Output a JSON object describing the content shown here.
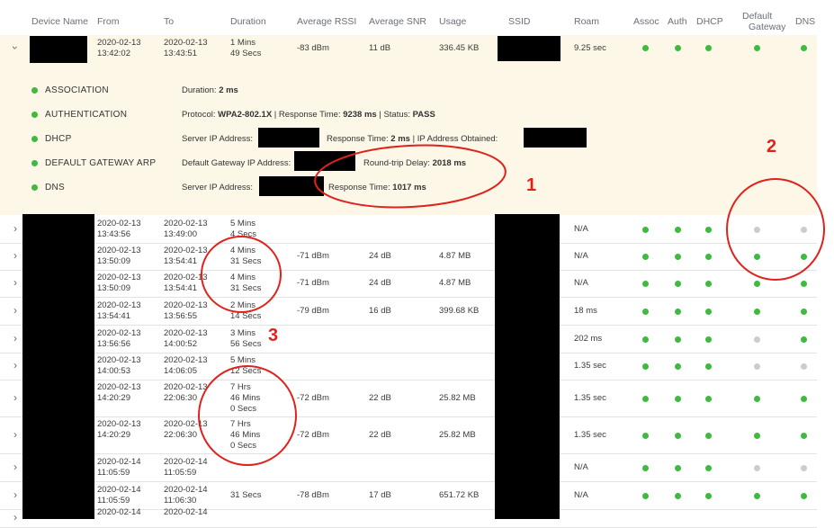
{
  "headers": [
    "Device Name",
    "From",
    "To",
    "Duration",
    "Average RSSI",
    "Average SNR",
    "Usage",
    "SSID",
    "Roam",
    "Assoc",
    "Auth",
    "DHCP",
    "Default",
    "Gateway",
    "DNS"
  ],
  "expanded_row": {
    "from": [
      "2020-02-13",
      "13:42:02"
    ],
    "to": [
      "2020-02-13",
      "13:43:51"
    ],
    "duration": [
      "1 Mins",
      "49 Secs"
    ],
    "rssi": "-83 dBm",
    "snr": "11 dB",
    "usage": "336.45 KB",
    "roam": "9.25 sec",
    "status": [
      "g",
      "g",
      "g",
      "g",
      "g"
    ]
  },
  "details": [
    {
      "label": "ASSOCIATION",
      "segments": [
        [
          "Duration: ",
          ""
        ],
        [
          "2 ms",
          "b"
        ]
      ]
    },
    {
      "label": "AUTHENTICATION",
      "segments": [
        [
          "Protocol: ",
          ""
        ],
        [
          "WPA2-802.1X",
          "b"
        ],
        [
          "  |  Response Time: ",
          ""
        ],
        [
          "9238 ms",
          "b"
        ],
        [
          "  |  Status: ",
          ""
        ],
        [
          "PASS",
          "b"
        ]
      ]
    },
    {
      "label": "DHCP",
      "segments": [
        [
          "Server IP Address: ",
          ""
        ]
      ],
      "extra": [
        [
          "Response Time: ",
          ""
        ],
        [
          "2 ms",
          "b"
        ],
        [
          "  |  IP Address Obtained: ",
          ""
        ]
      ]
    },
    {
      "label": "DEFAULT GATEWAY ARP",
      "segments": [
        [
          "Default Gateway IP Address: ",
          ""
        ]
      ],
      "extra": [
        [
          "Round-trip Delay: ",
          ""
        ],
        [
          "2018 ms",
          "b"
        ]
      ]
    },
    {
      "label": "DNS",
      "segments": [
        [
          "Server IP Address: ",
          ""
        ]
      ],
      "extra": [
        [
          "Response Time: ",
          ""
        ],
        [
          "1017 ms",
          "b"
        ]
      ]
    }
  ],
  "rows": [
    {
      "from": [
        "2020-02-13",
        "13:43:56"
      ],
      "to": [
        "2020-02-13",
        "13:49:00"
      ],
      "dur": [
        "5 Mins",
        "4 Secs"
      ],
      "rssi": "",
      "snr": "",
      "usage": "",
      "roam": "N/A",
      "st": [
        "g",
        "g",
        "g",
        "gr",
        "gr"
      ]
    },
    {
      "from": [
        "2020-02-13",
        "13:50:09"
      ],
      "to": [
        "2020-02-13",
        "13:54:41"
      ],
      "dur": [
        "4 Mins",
        "31 Secs"
      ],
      "rssi": "-71 dBm",
      "snr": "24 dB",
      "usage": "4.87 MB",
      "roam": "N/A",
      "st": [
        "g",
        "g",
        "g",
        "g",
        "g"
      ]
    },
    {
      "from": [
        "2020-02-13",
        "13:50:09"
      ],
      "to": [
        "2020-02-13",
        "13:54:41"
      ],
      "dur": [
        "4 Mins",
        "31 Secs"
      ],
      "rssi": "-71 dBm",
      "snr": "24 dB",
      "usage": "4.87 MB",
      "roam": "N/A",
      "st": [
        "g",
        "g",
        "g",
        "g",
        "g"
      ]
    },
    {
      "from": [
        "2020-02-13",
        "13:54:41"
      ],
      "to": [
        "2020-02-13",
        "13:56:55"
      ],
      "dur": [
        "2 Mins",
        "14 Secs"
      ],
      "rssi": "-79 dBm",
      "snr": "16 dB",
      "usage": "399.68 KB",
      "roam": "18 ms",
      "st": [
        "g",
        "g",
        "g",
        "g",
        "g"
      ]
    },
    {
      "from": [
        "2020-02-13",
        "13:56:56"
      ],
      "to": [
        "2020-02-13",
        "14:00:52"
      ],
      "dur": [
        "3 Mins",
        "56 Secs"
      ],
      "rssi": "",
      "snr": "",
      "usage": "",
      "roam": "202 ms",
      "st": [
        "g",
        "g",
        "g",
        "gr",
        "g"
      ]
    },
    {
      "from": [
        "2020-02-13",
        "14:00:53"
      ],
      "to": [
        "2020-02-13",
        "14:06:05"
      ],
      "dur": [
        "5 Mins",
        "12 Secs"
      ],
      "rssi": "",
      "snr": "",
      "usage": "",
      "roam": "1.35 sec",
      "st": [
        "g",
        "g",
        "g",
        "gr",
        "gr"
      ]
    },
    {
      "from": [
        "2020-02-13",
        "14:20:29"
      ],
      "to": [
        "2020-02-13",
        "22:06:30"
      ],
      "dur": [
        "7 Hrs",
        "46 Mins",
        "0 Secs"
      ],
      "rssi": "-72 dBm",
      "snr": "22 dB",
      "usage": "25.82 MB",
      "roam": "1.35 sec",
      "st": [
        "g",
        "g",
        "g",
        "g",
        "g"
      ]
    },
    {
      "from": [
        "2020-02-13",
        "14:20:29"
      ],
      "to": [
        "2020-02-13",
        "22:06:30"
      ],
      "dur": [
        "7 Hrs",
        "46 Mins",
        "0 Secs"
      ],
      "rssi": "-72 dBm",
      "snr": "22 dB",
      "usage": "25.82 MB",
      "roam": "1.35 sec",
      "st": [
        "g",
        "g",
        "g",
        "g",
        "g"
      ]
    },
    {
      "from": [
        "2020-02-14",
        "11:05:59"
      ],
      "to": [
        "2020-02-14",
        "11:05:59"
      ],
      "dur": [],
      "rssi": "",
      "snr": "",
      "usage": "",
      "roam": "N/A",
      "st": [
        "g",
        "g",
        "g",
        "gr",
        "gr"
      ]
    },
    {
      "from": [
        "2020-02-14",
        "11:05:59"
      ],
      "to": [
        "2020-02-14",
        "11:06:30"
      ],
      "dur": [
        "31 Secs"
      ],
      "rssi": "-78 dBm",
      "snr": "17 dB",
      "usage": "651.72 KB",
      "roam": "N/A",
      "st": [
        "g",
        "g",
        "g",
        "g",
        "g"
      ]
    },
    {
      "from": [
        "2020-02-14",
        ""
      ],
      "to": [
        "2020-02-14",
        ""
      ],
      "dur": [],
      "rssi": "",
      "snr": "",
      "usage": "",
      "roam": "",
      "st": []
    }
  ],
  "annotations": [
    "1",
    "2",
    "3"
  ],
  "colors": {
    "green": "#3fb93f",
    "grey": "#c8cdd2",
    "detail_bg": "#fdf7e8",
    "red": "#e0221c"
  }
}
